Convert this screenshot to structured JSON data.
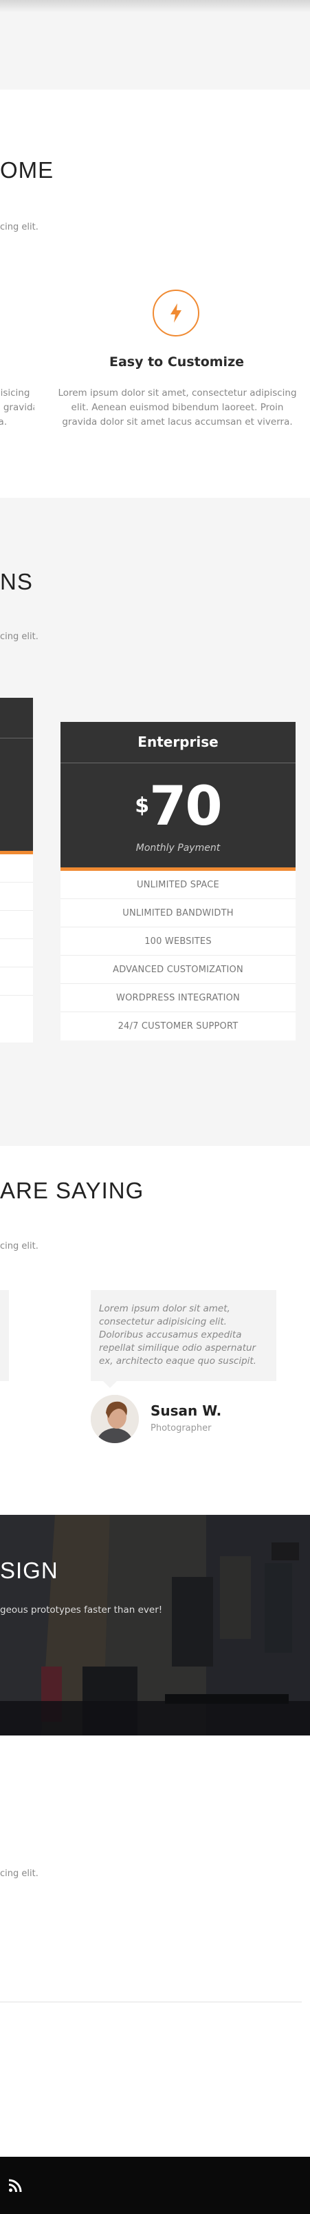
{
  "features": {
    "title_fragment": "OME",
    "subtitle_fragment": "cing elit.",
    "icon": "bolt-icon",
    "item": {
      "title": "Easy to Customize",
      "text": "Lorem ipsum dolor sit amet, consectetur adipiscing elit. Aenean euismod bibendum laoreet. Proin gravida dolor sit amet lacus accumsan et viverra."
    },
    "left_fragment": [
      "disicing",
      "n gravida",
      "ra."
    ]
  },
  "pricing": {
    "title_fragment": "NS",
    "subtitle_fragment": "cing elit.",
    "plan": {
      "name": "Enterprise",
      "currency": "$",
      "price": "70",
      "period": "Monthly Payment",
      "features": [
        "UNLIMITED SPACE",
        "UNLIMITED BANDWIDTH",
        "100 WEBSITES",
        "ADVANCED CUSTOMIZATION",
        "WORDPRESS INTEGRATION",
        "24/7 CUSTOMER SUPPORT"
      ]
    }
  },
  "testimonials": {
    "title_fragment": "ARE SAYING",
    "subtitle_fragment": "cing elit.",
    "quote": "Lorem ipsum dolor sit amet, consectetur adipisicing elit. Doloribus accusamus expedita repellat similique odio aspernatur ex, architecto eaque quo suscipit.",
    "name": "Susan W.",
    "role": "Photographer"
  },
  "banner": {
    "title_fragment": "SIGN",
    "text_fragment": "geous prototypes faster than ever!"
  },
  "contact": {
    "subtitle_fragment": "cing elit."
  },
  "footer": {
    "icon": "rss-icon"
  },
  "colors": {
    "accent": "#f08a32",
    "dark": "#333333",
    "section_bg": "#f5f5f5",
    "footer_bg": "#0a0a0a"
  }
}
